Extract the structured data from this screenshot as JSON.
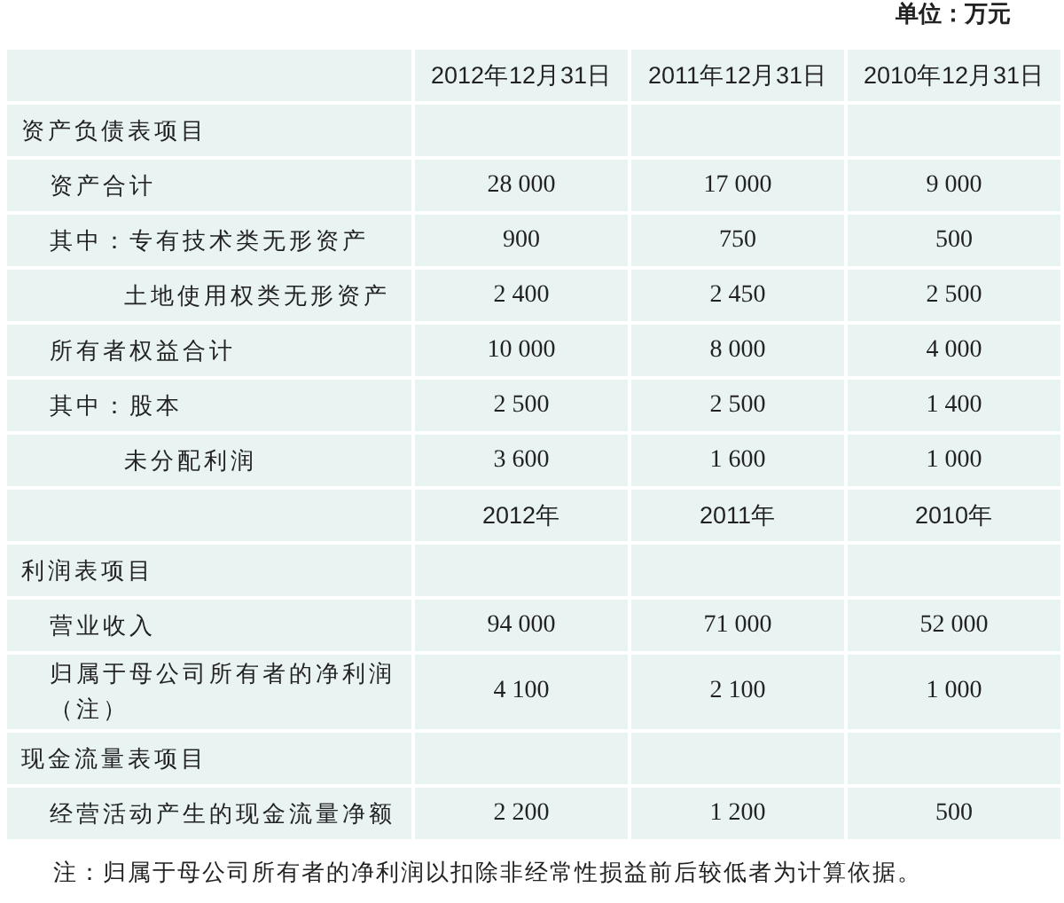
{
  "unit": "单位：万元",
  "rows": [
    {
      "kind": "header",
      "cells": [
        "",
        "2012年12月31日",
        "2011年12月31日",
        "2010年12月31日"
      ]
    },
    {
      "kind": "section",
      "cells": [
        "资产负债表项目",
        "",
        "",
        ""
      ]
    },
    {
      "kind": "item",
      "cells": [
        "资产合计",
        "28 000",
        "17 000",
        "9 000"
      ]
    },
    {
      "kind": "item",
      "cells": [
        "其中：专有技术类无形资产",
        "900",
        "750",
        "500"
      ]
    },
    {
      "kind": "subitem",
      "cells": [
        "土地使用权类无形资产",
        "2 400",
        "2 450",
        "2 500"
      ]
    },
    {
      "kind": "item",
      "cells": [
        "所有者权益合计",
        "10 000",
        "8 000",
        "4 000"
      ]
    },
    {
      "kind": "item",
      "cells": [
        "其中：股本",
        "2 500",
        "2 500",
        "1 400"
      ]
    },
    {
      "kind": "subitem",
      "cells": [
        "未分配利润",
        "3 600",
        "1 600",
        "1 000"
      ]
    },
    {
      "kind": "header",
      "cells": [
        "",
        "2012年",
        "2011年",
        "2010年"
      ]
    },
    {
      "kind": "section",
      "cells": [
        "利润表项目",
        "",
        "",
        ""
      ]
    },
    {
      "kind": "item",
      "cells": [
        "营业收入",
        "94 000",
        "71 000",
        "52 000"
      ]
    },
    {
      "kind": "item",
      "cells": [
        "归属于母公司所有者的净利润（注）",
        "4 100",
        "2 100",
        "1 000"
      ]
    },
    {
      "kind": "section",
      "cells": [
        "现金流量表项目",
        "",
        "",
        ""
      ]
    },
    {
      "kind": "item",
      "cells": [
        "经营活动产生的现金流量净额",
        "2 200",
        "1 200",
        "500"
      ]
    }
  ],
  "note": "注：归属于母公司所有者的净利润以扣除非经常性损益前后较低者为计算依据。"
}
